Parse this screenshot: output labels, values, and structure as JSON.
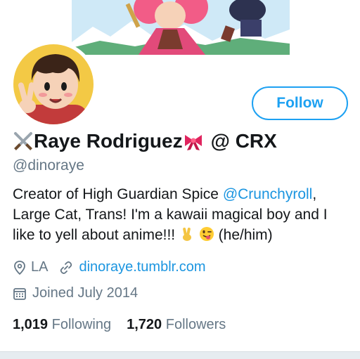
{
  "profile": {
    "name": "Raye Rodriguez",
    "name_suffix": "@ CRX",
    "handle": "@dinoraye",
    "bio": {
      "part1": "Creator of High Guardian Spice ",
      "mention": "@Crunchyroll",
      "part2": ", Large Cat, Trans! I'm a kawaii magical boy and I like to yell about anime!!! ",
      "part3": " (he/him)"
    },
    "location": "LA",
    "website": "dinoraye.tumblr.com",
    "joined": "Joined July 2014",
    "following_count": "1,019",
    "following_label": "Following",
    "followers_count": "1,720",
    "followers_label": "Followers"
  },
  "actions": {
    "follow_label": "Follow"
  },
  "icons": {
    "name_prefix": "crossed-swords-icon",
    "name_bow": "ribbon-icon",
    "bio_emoji_1": "victory-hand-icon",
    "bio_emoji_2": "winking-tongue-face-icon",
    "location": "location-pin-icon",
    "website": "link-icon",
    "joined": "calendar-icon"
  },
  "colors": {
    "accent": "#1da1f2",
    "link": "#1b95e0",
    "secondary_text": "#657786"
  }
}
